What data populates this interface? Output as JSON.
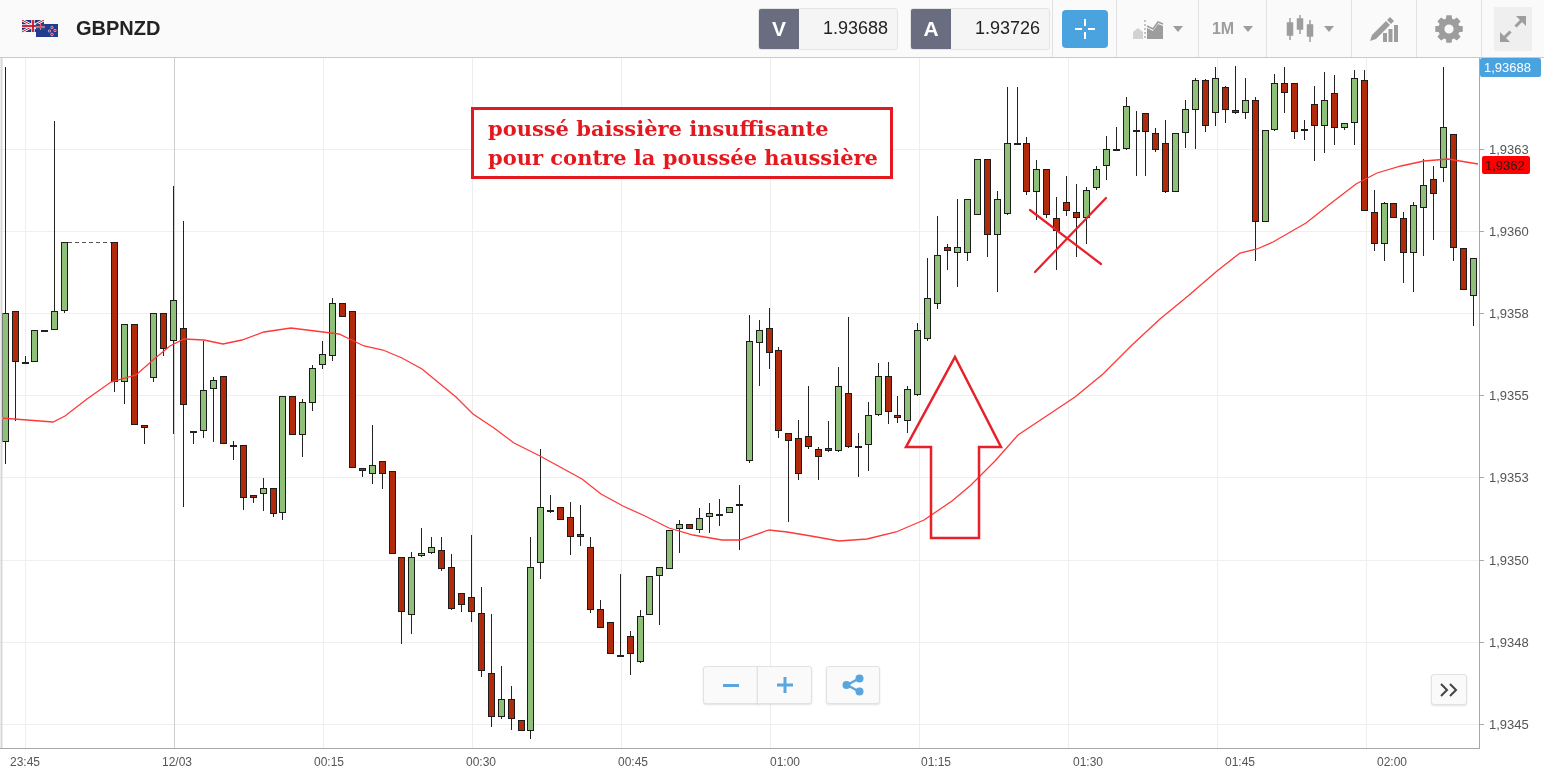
{
  "header": {
    "symbol": "GBPNZD",
    "quotes": [
      {
        "label": "V",
        "value": "1.93688"
      },
      {
        "label": "A",
        "value": "1.93726"
      }
    ],
    "tools": [
      {
        "kind": "crosshair",
        "active": true
      },
      {
        "kind": "chart_type",
        "active": false,
        "dropdown": true
      },
      {
        "kind": "timeframe",
        "label": "1M",
        "active": false,
        "dropdown": true
      },
      {
        "kind": "candle_style",
        "active": false,
        "dropdown": true
      },
      {
        "kind": "drawing",
        "active": false
      },
      {
        "kind": "settings",
        "active": false
      },
      {
        "kind": "fullscreen",
        "active": false
      }
    ]
  },
  "chart": {
    "price_labels": [
      "1,9363",
      "1,9360",
      "1,9358",
      "1,9355",
      "1,9353",
      "1,9350",
      "1,9348",
      "1,9345"
    ],
    "time_labels": [
      {
        "text": "23:45",
        "kind": "time"
      },
      {
        "text": "12/03",
        "kind": "date"
      },
      {
        "text": "00:15",
        "kind": "time"
      },
      {
        "text": "00:30",
        "kind": "time"
      },
      {
        "text": "00:45",
        "kind": "time"
      },
      {
        "text": "01:00",
        "kind": "time"
      },
      {
        "text": "01:15",
        "kind": "time"
      },
      {
        "text": "01:30",
        "kind": "time"
      },
      {
        "text": "01:45",
        "kind": "time"
      },
      {
        "text": "02:00",
        "kind": "time"
      }
    ],
    "last_price": "1,93688",
    "indicator_value": "1,9362",
    "note": {
      "lines": [
        "poussé baissière insuffisante",
        "pour contre la poussée haussière"
      ]
    }
  },
  "controls": [
    {
      "kind": "zoom_out"
    },
    {
      "kind": "zoom_in"
    },
    {
      "kind": "share"
    },
    {
      "kind": "scroll_end"
    }
  ]
}
